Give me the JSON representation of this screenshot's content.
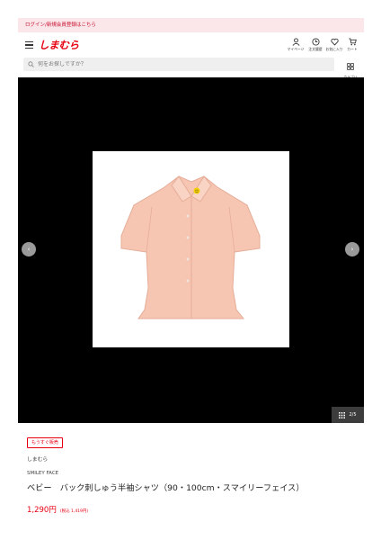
{
  "login_banner": "ログイン/新規会員登録はこちら",
  "logo": "しまむら",
  "nav": [
    {
      "label": "マイページ",
      "icon": "user-icon"
    },
    {
      "label": "注文履歴",
      "icon": "clock-icon"
    },
    {
      "label": "お気に入り",
      "icon": "heart-icon"
    },
    {
      "label": "カート",
      "icon": "cart-icon"
    }
  ],
  "search": {
    "placeholder": "何をお探しですか？"
  },
  "category_label": "カテゴリ",
  "gallery": {
    "counter": "2/5",
    "prev_label": "‹",
    "next_label": "›"
  },
  "product": {
    "badge": "もうすぐ販売",
    "brand": "しまむら",
    "series": "SMILEY FACE",
    "title": "ベビー　バック刺しゅう半袖シャツ（90・100cm・スマイリーフェイス）",
    "price": "1,290円",
    "tax_price": "(税込 1,419円)"
  },
  "colors": {
    "brand_red": "#e60012",
    "banner_bg": "#fbe7ea",
    "shirt": "#f6c6b3"
  }
}
